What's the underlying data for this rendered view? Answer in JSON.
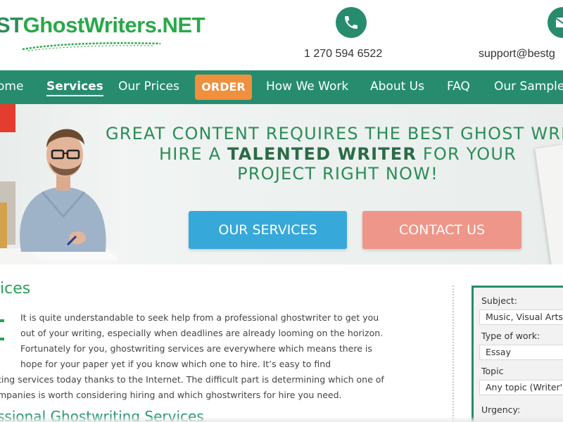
{
  "header": {
    "logo_part1": "ST",
    "logo_part2": "GhostWriters.NET",
    "phone": "1 270 594 6522",
    "email": "support@bestg",
    "phone_icon": "phone-icon",
    "mail_icon": "mail-icon"
  },
  "nav": {
    "items": [
      "ome",
      "Services",
      "Our Prices",
      "How We Work",
      "About Us",
      "FAQ",
      "Our Sample"
    ],
    "order_label": "ORDER",
    "active": "Services"
  },
  "hero": {
    "line1": "GREAT CONTENT REQUIRES THE BEST GHOST WRIT",
    "line2_a": "HIRE A ",
    "line2_b": "TALENTED WRITER",
    "line2_c": " FOR YOUR",
    "line3": "PROJECT RIGHT NOW!",
    "services_button": "OUR SERVICES",
    "contact_button": "CONTACT US"
  },
  "content": {
    "title": "ices",
    "lines": [
      "It is quite understandable to seek help from a professional ghostwriter to get you",
      "out of your writing, especially when deadlines are already looming on the horizon.",
      "Fortunately for you, ghostwriting services are everywhere which means there is",
      "hope for your paper yet if you know which one to hire. It’s easy to find",
      "ting services today thanks to the Internet. The difficult part is determining which one of",
      "mpanies is worth considering hiring and which ghostwriters for hire you need."
    ],
    "subtitle": "ssional Ghostwriting Services"
  },
  "form": {
    "subject_label": "Subject:",
    "subject_value": "Music, Visual Arts,",
    "type_label": "Type of work:",
    "type_value": "Essay",
    "topic_label": "Topic",
    "topic_value": "Any topic (Writer's",
    "urgency_label": "Urgency:"
  },
  "colors": {
    "brand_green": "#268c6d",
    "order_orange": "#f08f3c",
    "services_blue": "#37a8da",
    "contact_pink": "#ef968a",
    "heading_green": "#2c8c58"
  }
}
